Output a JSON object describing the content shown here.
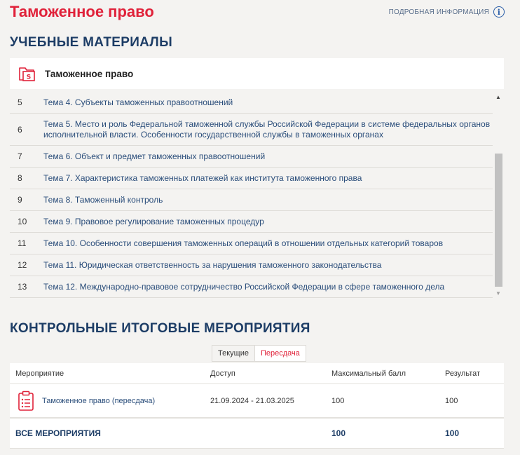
{
  "header": {
    "title": "Таможенное право",
    "info_label": "ПОДРОБНАЯ ИНФОРМАЦИЯ",
    "info_icon": "info-icon"
  },
  "materials": {
    "section_title": "УЧЕБНЫЕ МАТЕРИАЛЫ",
    "course_name": "Таможенное право",
    "course_icon": "folder-icon",
    "topics": [
      {
        "num": "5",
        "title": "Тема 4. Субъекты таможенных правоотношений"
      },
      {
        "num": "6",
        "title": "Тема 5. Место и роль Федеральной таможенной службы Российской Федерации в системе федеральных органов исполнительной власти. Особенности государственной службы в таможенных органах"
      },
      {
        "num": "7",
        "title": "Тема 6. Объект и предмет таможенных правоотношений"
      },
      {
        "num": "8",
        "title": "Тема 7. Характеристика таможенных платежей как института таможенного права"
      },
      {
        "num": "9",
        "title": "Тема 8. Таможенный контроль"
      },
      {
        "num": "10",
        "title": "Тема 9. Правовое регулирование таможенных процедур"
      },
      {
        "num": "11",
        "title": "Тема 10. Особенности совершения таможенных операций в отношении отдельных категорий товаров"
      },
      {
        "num": "12",
        "title": "Тема 11. Юридическая ответственность за нарушения таможенного законодательства"
      },
      {
        "num": "13",
        "title": "Тема 12. Международно-правовое сотрудничество Российской Федерации в сфере таможенного дела"
      }
    ]
  },
  "events": {
    "section_title": "КОНТРОЛЬНЫЕ ИТОГОВЫЕ МЕРОПРИЯТИЯ",
    "tabs": [
      "Текущие",
      "Пересдача"
    ],
    "active_tab": "Пересдача",
    "columns": [
      "Мероприятие",
      "Доступ",
      "Максимальный балл",
      "Результат"
    ],
    "rows": [
      {
        "name": "Таможенное право (пересдача)",
        "access": "21.09.2024 - 21.03.2025",
        "max": "100",
        "result": "100",
        "icon": "clipboard-icon"
      }
    ],
    "total": {
      "label": "ВСЕ МЕРОПРИЯТИЯ",
      "max": "100",
      "result": "100"
    }
  },
  "colors": {
    "accent": "#e0223a",
    "heading": "#1d3d66",
    "link": "#2a4d7a"
  }
}
